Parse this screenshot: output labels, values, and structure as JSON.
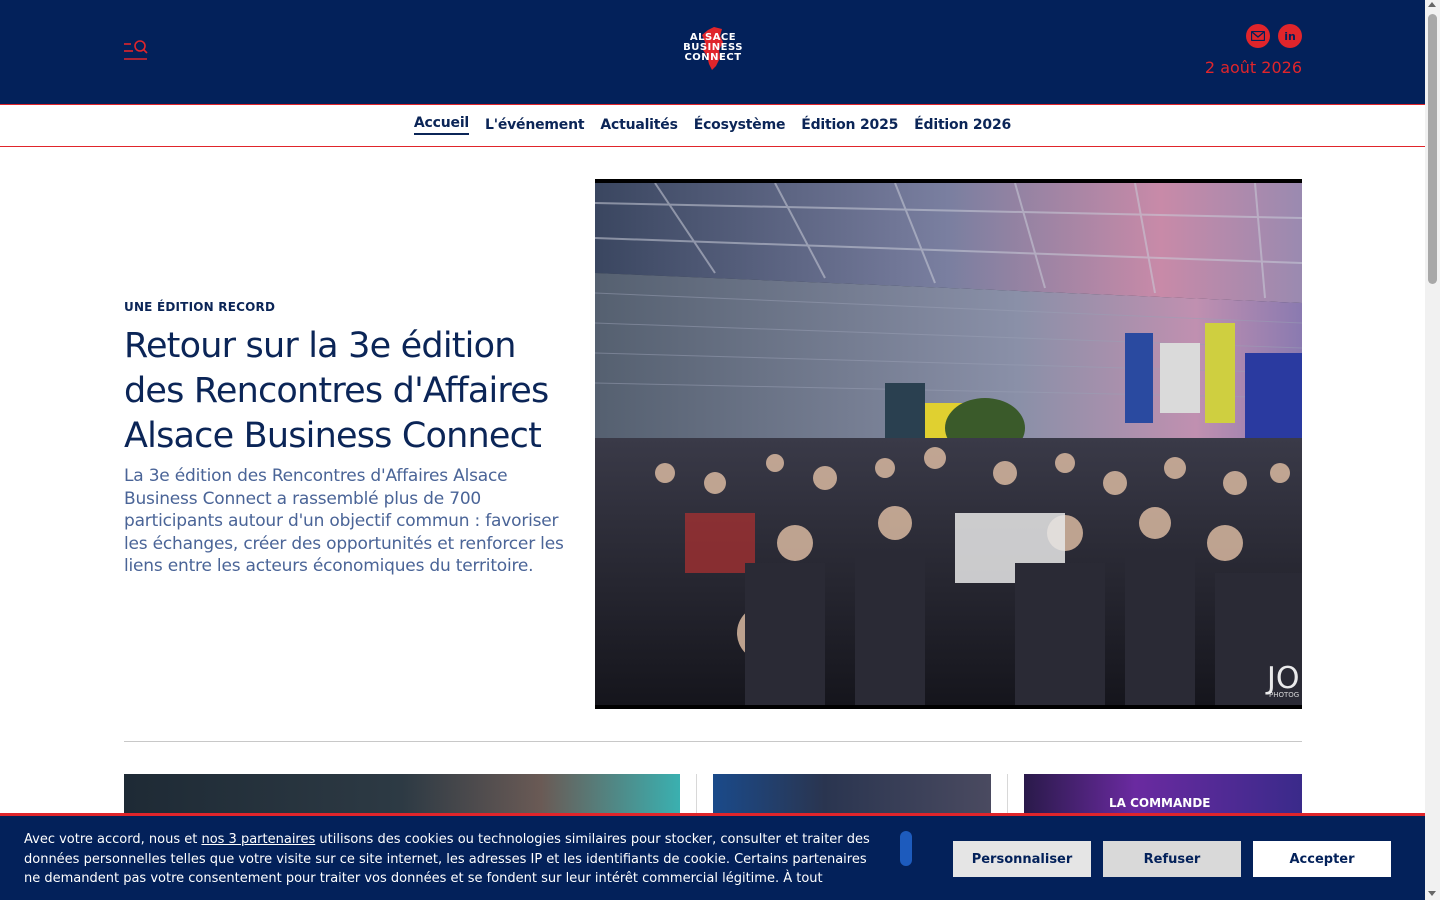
{
  "header": {
    "logo": {
      "line1": "ALSACE",
      "line2": "BUSINESS",
      "line3": "CONNECT"
    },
    "date": "2 août 2026",
    "social": {
      "mail_icon": "mail-icon",
      "linkedin_label": "in"
    }
  },
  "nav": {
    "items": [
      {
        "label": "Accueil"
      },
      {
        "label": "L'événement"
      },
      {
        "label": "Actualités"
      },
      {
        "label": "Écosystème"
      },
      {
        "label": "Édition 2025"
      },
      {
        "label": "Édition 2026"
      }
    ],
    "active": "Accueil"
  },
  "hero": {
    "kicker": "UNE ÉDITION RECORD",
    "title": "Retour sur la 3e édition des Rencontres d'Affaires Alsace Business Connect",
    "description": "La 3e édition des Rencontres d'Affaires Alsace Business Connect a rassemblé plus de 700 participants autour d'un objectif commun : favoriser les échanges, créer des opportunités et renforcer les liens entre les acteurs économiques du territoire.",
    "image_watermark": "JO",
    "image_watermark_sub": "PHOTOG"
  },
  "thumbs": {
    "t3_label": "LA COMMANDE"
  },
  "cookie": {
    "text_before": "Avec votre accord, nous et ",
    "link": "nos 3 partenaires",
    "text_after": " utilisons des cookies ou technologies similaires pour stocker, consulter et traiter des données personnelles telles que votre visite sur ce site internet, les adresses IP et les identifiants de cookie. Certains partenaires ne demandent pas votre consentement pour traiter vos données et se fondent sur leur intérêt commercial légitime. À tout",
    "personalize": "Personnaliser",
    "refuse": "Refuser",
    "accept": "Accepter"
  },
  "colors": {
    "navy": "#03215a",
    "red": "#e0252b",
    "text": "#0b2557"
  }
}
